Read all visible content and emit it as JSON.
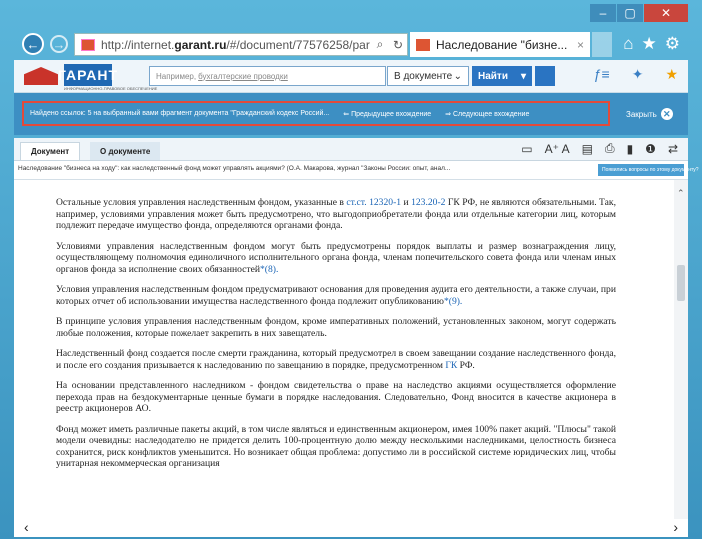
{
  "window": {
    "min_icon": "minimize-icon",
    "max_icon": "maximize-icon",
    "close_icon": "close-icon"
  },
  "browser": {
    "url_prefix": "http://internet.",
    "url_domain": "garant.ru",
    "url_rest": "/#/document/77576258/par",
    "tab_title": "Наследование \"бизне...",
    "tab_close": "×",
    "icons": [
      "home-icon",
      "star-icon",
      "gear-icon"
    ]
  },
  "garant": {
    "logo": "ГАРАНТ",
    "logo_sub": "ИНФОРМАЦИОННО-ПРАВОВОЕ ОБЕСПЕЧЕНИЕ",
    "search_placeholder": "Например,",
    "search_example": "бухгалтерские проводки",
    "scope": "В документе",
    "find": "Найти"
  },
  "found_bar": {
    "message": "Найдено ссылок: 5 на выбранный вами фрагмент документа \"Гражданский кодекс Россий...",
    "prev": "Предыдущее вхождение",
    "next": "Следующее вхождение",
    "close": "Закрыть"
  },
  "doc_tabs": {
    "document": "Документ",
    "about": "О документе"
  },
  "doc": {
    "title": "Наследование \"бизнеса на ходу\": как наследственный фонд может управлять акциями? (О.А. Макарова, журнал \"Законы России: опыт, анал...",
    "ask": "Появились вопросы по этому документу?",
    "p1_a": "Остальные условия управления наследственным фондом, указанные в ",
    "p1_link1": "ст.ст. 12320-1",
    "p1_b": " и ",
    "p1_link2": "123.20-2",
    "p1_c": " ГК РФ, не являются обязательными. Так, например, условиями управления может быть предусмотрено, что выгодоприобретатели фонда или отдельные категории лиц, которым подлежит передаче имущество фонда, определяются органами фонда.",
    "p2": "Условиями управления наследственным фондом могут быть предусмотрены порядок выплаты и размер вознаграждения лицу, осуществляющему полномочия единоличного исполнительного органа фонда, членам попечительского совета фонда или членам иных органов фонда за исполнение своих обязанностей",
    "p2_ref": "*(8).",
    "p3": "Условия управления наследственным фондом предусматривают основания для проведения аудита его деятельности, а также случаи, при которых отчет об использовании имущества наследственного фонда подлежит опубликованию",
    "p3_ref": "*(9).",
    "p4": "В принципе условия управления наследственным фондом, кроме императивных положений, установленных законом, могут содержать любые положения, которые пожелает закрепить в них завещатель.",
    "p5_a": "Наследственный фонд создается после смерти гражданина, который предусмотрел в своем завещании создание наследственного фонда, и после его создания призывается к наследованию по завещанию в порядке, предусмотренном ",
    "p5_link": "ГК",
    "p5_b": " РФ.",
    "p6": "На основании представленного наследником - фондом свидетельства о праве на наследство акциями осуществляется оформление перехода прав на бездокументарные ценные бумаги в порядке наследования. Следовательно, Фонд вносится в качестве акционера в реестр акционеров АО.",
    "p7": "Фонд может иметь различные пакеты акций, в том числе являться и единственным акционером, имея 100% пакет акций. \"Плюсы\" такой модели очевидны: наследодателю не придется делить 100-процентную долю между несколькими наследниками, целостность бизнеса сохранится, риск конфликтов уменьшится. Но возникает общая проблема: допустимо ли в российской системе юридических лиц, чтобы унитарная некоммерческая организация"
  }
}
